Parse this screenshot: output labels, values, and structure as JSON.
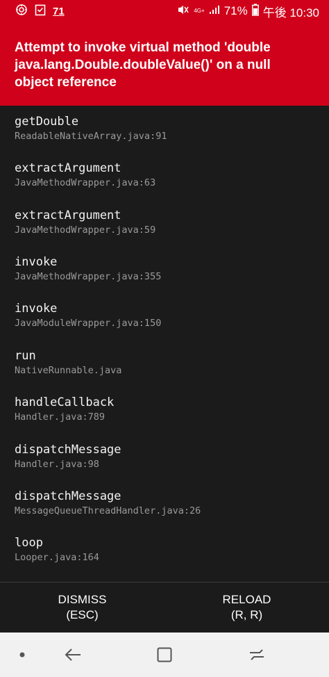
{
  "status_bar": {
    "left_icons": [
      "gear-icon",
      "clipboard-check-icon"
    ],
    "notification_number": "71",
    "network_type": "4G+",
    "battery_percent": "71%",
    "time": "午後 10:30"
  },
  "error": {
    "message_line1": "Attempt to invoke virtual method 'double",
    "message_line2": "java.lang.Double.doubleValue()' on a null",
    "message_line3": "object reference"
  },
  "stack_frames": [
    {
      "method": "getDouble",
      "file": "ReadableNativeArray.java:91"
    },
    {
      "method": "extractArgument",
      "file": "JavaMethodWrapper.java:63"
    },
    {
      "method": "extractArgument",
      "file": "JavaMethodWrapper.java:59"
    },
    {
      "method": "invoke",
      "file": "JavaMethodWrapper.java:355"
    },
    {
      "method": "invoke",
      "file": "JavaModuleWrapper.java:150"
    },
    {
      "method": "run",
      "file": "NativeRunnable.java"
    },
    {
      "method": "handleCallback",
      "file": "Handler.java:789"
    },
    {
      "method": "dispatchMessage",
      "file": "Handler.java:98"
    },
    {
      "method": "dispatchMessage",
      "file": "MessageQueueThreadHandler.java:26"
    },
    {
      "method": "loop",
      "file": "Looper.java:164"
    }
  ],
  "actions": {
    "dismiss_label": "DISMISS",
    "dismiss_shortcut": "(ESC)",
    "reload_label": "RELOAD",
    "reload_shortcut": "(R, R)"
  },
  "nav_bar": {
    "icons": [
      "dot-icon",
      "back-arrow-icon",
      "home-square-icon",
      "recents-icon"
    ]
  },
  "colors": {
    "error_red": "#d0021b",
    "stack_background": "#1b1b1b",
    "nav_background": "#f1f1f1"
  }
}
